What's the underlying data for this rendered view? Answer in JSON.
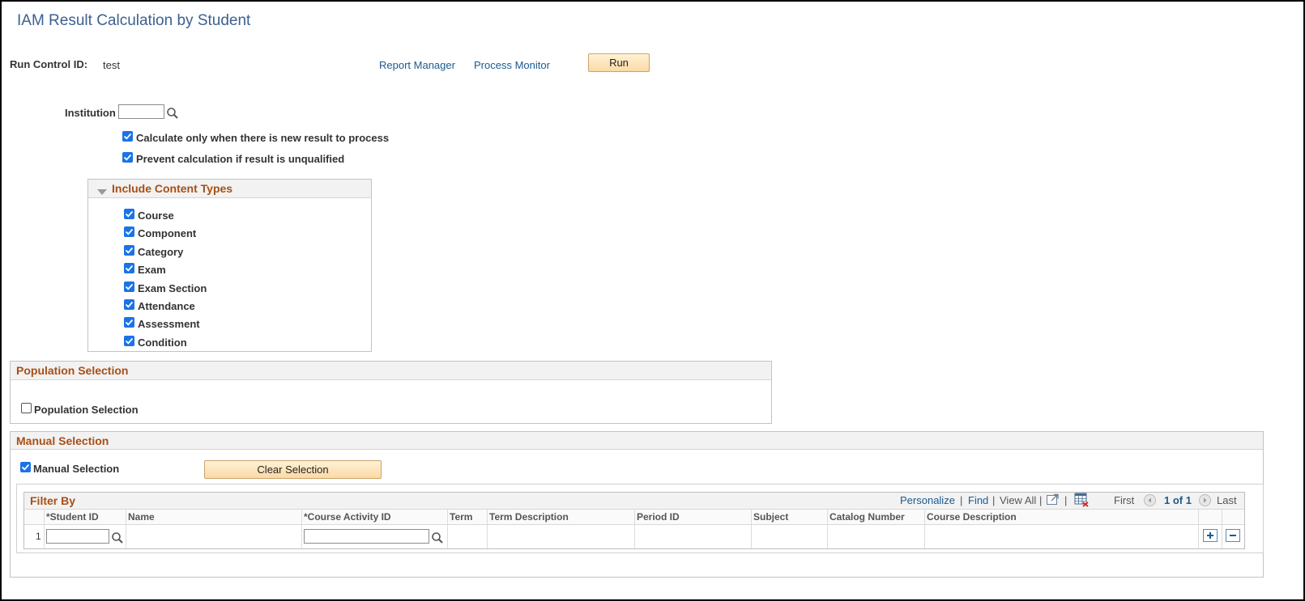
{
  "page": {
    "title": "IAM Result Calculation by Student"
  },
  "run_control": {
    "label": "Run Control ID:",
    "value": "test",
    "report_manager": "Report Manager",
    "process_monitor": "Process Monitor",
    "run_label": "Run"
  },
  "institution": {
    "label": "Institution",
    "value": ""
  },
  "options": [
    {
      "label": "Calculate only when there is new result to process",
      "checked": true
    },
    {
      "label": "Prevent calculation if result is unqualified",
      "checked": true
    }
  ],
  "content_types": {
    "title": "Include Content Types",
    "items": [
      {
        "label": "Course",
        "checked": true
      },
      {
        "label": "Component",
        "checked": true
      },
      {
        "label": "Category",
        "checked": true
      },
      {
        "label": "Exam",
        "checked": true
      },
      {
        "label": "Exam Section",
        "checked": true
      },
      {
        "label": "Attendance",
        "checked": true
      },
      {
        "label": "Assessment",
        "checked": true
      },
      {
        "label": "Condition",
        "checked": true
      }
    ]
  },
  "population": {
    "title": "Population Selection",
    "checkbox_label": "Population Selection",
    "checked": false
  },
  "manual": {
    "title": "Manual Selection",
    "checkbox_label": "Manual Selection",
    "checked": true,
    "clear_label": "Clear Selection"
  },
  "filter": {
    "title": "Filter By",
    "personalize": "Personalize",
    "find": "Find",
    "view_all": "View All",
    "first": "First",
    "page_info": "1 of 1",
    "last": "Last",
    "sep": "|",
    "columns": [
      "*Student ID",
      "Name",
      "*Course Activity ID",
      "Term",
      "Term Description",
      "Period ID",
      "Subject",
      "Catalog Number",
      "Course Description"
    ],
    "rows": [
      {
        "num": "1",
        "student_id": "",
        "course_activity_id": ""
      }
    ]
  }
}
